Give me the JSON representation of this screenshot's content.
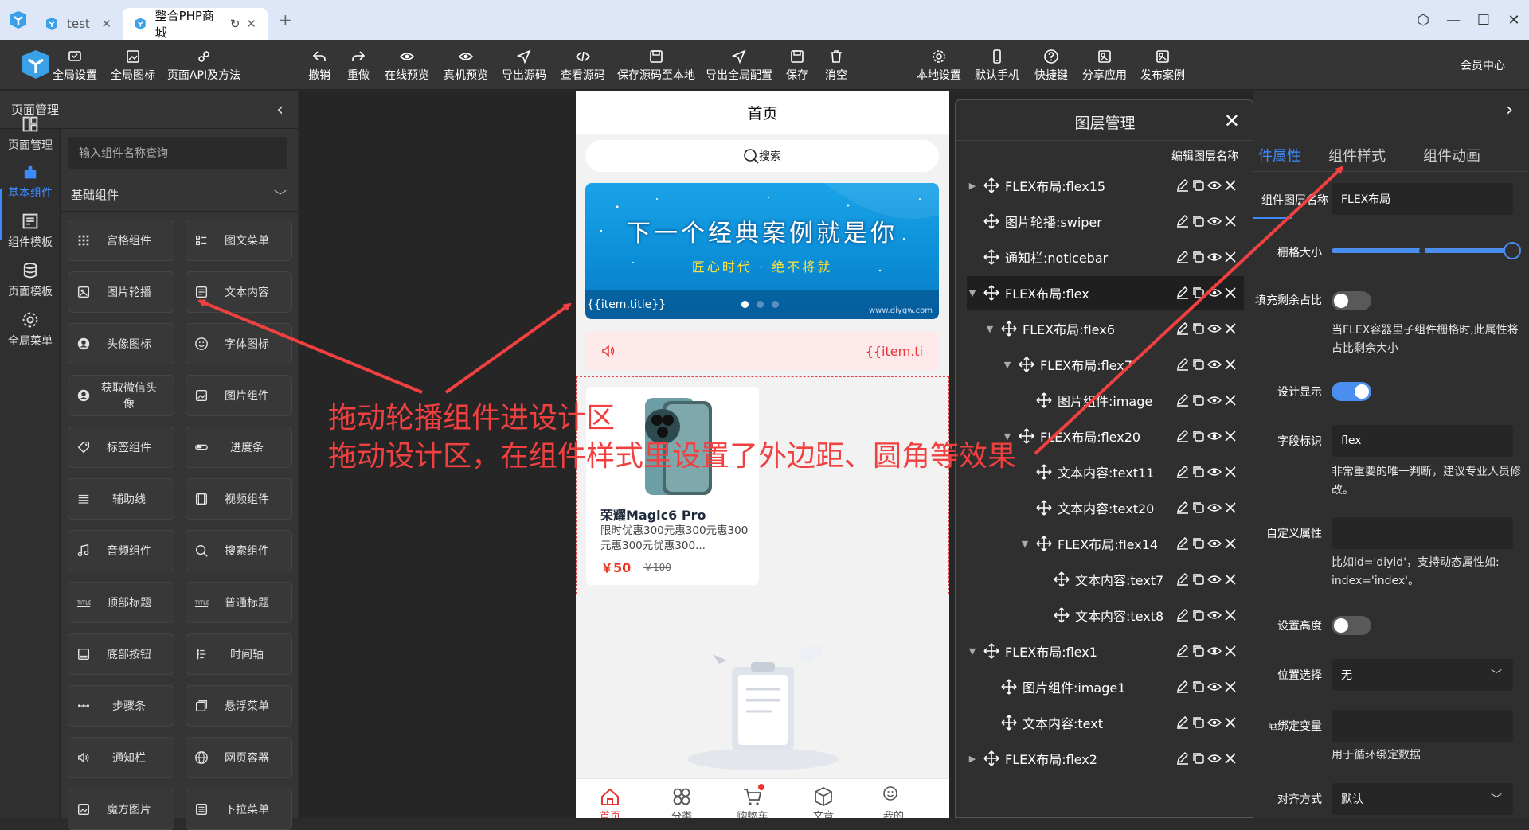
{
  "browser": {
    "tabs": [
      {
        "label": "test"
      },
      {
        "label": "整合PHP商城"
      }
    ]
  },
  "toolbar": {
    "left": [
      {
        "label": "全局设置",
        "icon": "settings-icon"
      },
      {
        "label": "全局图标",
        "icon": "image-icon"
      },
      {
        "label": "页面API及方法",
        "icon": "api-icon"
      }
    ],
    "center": [
      {
        "label": "撤销",
        "icon": "undo-icon"
      },
      {
        "label": "重做",
        "icon": "redo-icon"
      },
      {
        "label": "在线预览",
        "icon": "eye-icon"
      },
      {
        "label": "真机预览",
        "icon": "eye-icon"
      },
      {
        "label": "导出源码",
        "icon": "send-icon"
      },
      {
        "label": "查看源码",
        "icon": "code-icon"
      },
      {
        "label": "保存源码至本地",
        "icon": "save-icon"
      },
      {
        "label": "导出全局配置",
        "icon": "send-icon"
      },
      {
        "label": "保存",
        "icon": "save-icon"
      },
      {
        "label": "消空",
        "icon": "trash-icon"
      }
    ],
    "right": [
      {
        "label": "本地设置",
        "icon": "gear-icon"
      },
      {
        "label": "默认手机",
        "icon": "phone-icon"
      },
      {
        "label": "快捷键",
        "icon": "help-icon"
      },
      {
        "label": "分享应用",
        "icon": "share-icon"
      },
      {
        "label": "发布案例",
        "icon": "publish-icon"
      }
    ],
    "member": "会员中心"
  },
  "left_panel": {
    "title": "页面管理",
    "rail": [
      {
        "label": "页面管理",
        "icon": "layout-icon"
      },
      {
        "label": "基本组件",
        "icon": "puzzle-icon"
      },
      {
        "label": "组件模板",
        "icon": "template-icon"
      },
      {
        "label": "页面模板",
        "icon": "database-icon"
      },
      {
        "label": "全局菜单",
        "icon": "gear-icon"
      }
    ],
    "search_placeholder": "输入组件名称查询",
    "category": "基础组件",
    "components": [
      {
        "label": "宫格组件",
        "icon": "grid-icon"
      },
      {
        "label": "图文菜单",
        "icon": "list-icon"
      },
      {
        "label": "图片轮播",
        "icon": "swiper-icon"
      },
      {
        "label": "文本内容",
        "icon": "text-icon"
      },
      {
        "label": "头像图标",
        "icon": "avatar-icon"
      },
      {
        "label": "字体图标",
        "icon": "smile-icon"
      },
      {
        "label": "获取微信头像",
        "icon": "avatar-icon"
      },
      {
        "label": "图片组件",
        "icon": "image-icon"
      },
      {
        "label": "标签组件",
        "icon": "tag-icon"
      },
      {
        "label": "进度条",
        "icon": "progress-icon"
      },
      {
        "label": "辅助线",
        "icon": "lines-icon"
      },
      {
        "label": "视频组件",
        "icon": "video-icon"
      },
      {
        "label": "音频组件",
        "icon": "music-icon"
      },
      {
        "label": "搜索组件",
        "icon": "search-icon"
      },
      {
        "label": "顶部标题",
        "icon": "title-icon"
      },
      {
        "label": "普通标题",
        "icon": "title-icon"
      },
      {
        "label": "底部按钮",
        "icon": "bottom-icon"
      },
      {
        "label": "时间轴",
        "icon": "timeline-icon"
      },
      {
        "label": "步骤条",
        "icon": "steps-icon"
      },
      {
        "label": "悬浮菜单",
        "icon": "float-icon"
      },
      {
        "label": "通知栏",
        "icon": "speaker-icon"
      },
      {
        "label": "网页容器",
        "icon": "globe-icon"
      },
      {
        "label": "魔方图片",
        "icon": "image-icon"
      },
      {
        "label": "下拉菜单",
        "icon": "dropdown-icon"
      }
    ]
  },
  "phone": {
    "title": "首页",
    "search": "搜索",
    "banner_main": "下一个经典案例就是你",
    "banner_sub": "匠心时代 · 绝不将就",
    "banner_caption": "{{item.title}}",
    "banner_watermark": "www.diygw.com",
    "notice": "{{item.ti",
    "product": {
      "name": "荣耀Magic6 Pro",
      "desc": "限时优惠300元惠300元惠300元惠300元优惠300...",
      "price": "￥50",
      "old_price": "￥100"
    },
    "nav": [
      {
        "label": "首页",
        "icon": "home-icon"
      },
      {
        "label": "分类",
        "icon": "category-icon"
      },
      {
        "label": "购物车",
        "icon": "cart-icon"
      },
      {
        "label": "文章",
        "icon": "cube-icon"
      },
      {
        "label": "我的",
        "icon": "smile-icon"
      }
    ]
  },
  "layer_panel": {
    "title": "图层管理",
    "edit_name": "编辑图层名称",
    "rows": [
      {
        "label": "FLEX布局:flex15",
        "level": 0,
        "arrow": "right"
      },
      {
        "label": "图片轮播:swiper",
        "level": 0,
        "arrow": ""
      },
      {
        "label": "通知栏:noticebar",
        "level": 0,
        "arrow": ""
      },
      {
        "label": "FLEX布局:flex",
        "level": 0,
        "arrow": "down",
        "selected": true
      },
      {
        "label": "FLEX布局:flex6",
        "level": 1,
        "arrow": "down"
      },
      {
        "label": "FLEX布局:flex7",
        "level": 2,
        "arrow": "down"
      },
      {
        "label": "图片组件:image",
        "level": 3,
        "arrow": ""
      },
      {
        "label": "FLEX布局:flex20",
        "level": 2,
        "arrow": "down"
      },
      {
        "label": "文本内容:text11",
        "level": 3,
        "arrow": ""
      },
      {
        "label": "文本内容:text20",
        "level": 3,
        "arrow": ""
      },
      {
        "label": "FLEX布局:flex14",
        "level": 3,
        "arrow": "down"
      },
      {
        "label": "文本内容:text7",
        "level": 4,
        "arrow": ""
      },
      {
        "label": "文本内容:text8",
        "level": 4,
        "arrow": ""
      },
      {
        "label": "FLEX布局:flex1",
        "level": 0,
        "arrow": "down"
      },
      {
        "label": "图片组件:image1",
        "level": 1,
        "arrow": ""
      },
      {
        "label": "文本内容:text",
        "level": 1,
        "arrow": ""
      },
      {
        "label": "FLEX布局:flex2",
        "level": 0,
        "arrow": "right"
      }
    ]
  },
  "props_panel": {
    "tabs": [
      "件属性",
      "组件样式",
      "组件动画"
    ],
    "active_tab": 0,
    "layer_name_label": "组件图层名称",
    "layer_name_value": "FLEX布局",
    "grid_label": "栅格大小",
    "grid_value_pct": 100,
    "fill_label": "填充剩余占比",
    "fill_on": false,
    "fill_help": "当FLEX容器里子组件栅格时,此属性将占比剩余大小",
    "design_label": "设计显示",
    "design_on": true,
    "field_label": "字段标识",
    "field_value": "flex",
    "field_help": "非常重要的唯一判断，建议专业人员修改。",
    "custom_label": "自定义属性",
    "custom_value": "",
    "custom_help": "比如id='diyid'，支持动态属性如: index='index'。",
    "height_label": "设置高度",
    "height_on": false,
    "position_label": "位置选择",
    "position_value": "无",
    "bind_label": "绑定变量",
    "bind_value": "",
    "bind_help": "用于循环绑定数据",
    "align_label": "对齐方式",
    "align_value": "默认"
  },
  "annotations": {
    "line1": "拖动轮播组件进设计区",
    "line2": "拖动设计区，在组件样式里设置了外边距、圆角等效果"
  },
  "colors": {
    "accent": "#3d8bff",
    "annotation": "#f04040"
  }
}
